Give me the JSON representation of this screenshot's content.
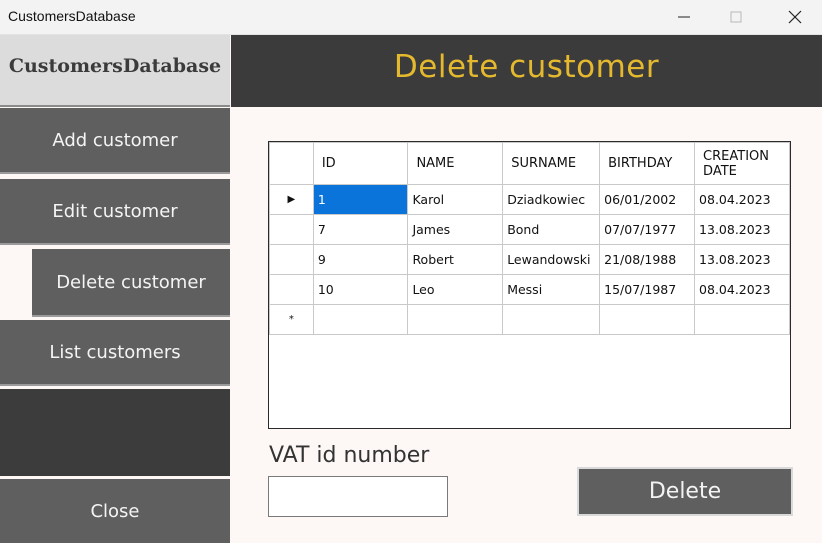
{
  "window": {
    "title": "CustomersDatabase"
  },
  "sidebar": {
    "brand": "CustomersDatabase",
    "items": [
      {
        "label": "Add customer"
      },
      {
        "label": "Edit customer"
      },
      {
        "label": "Delete customer"
      },
      {
        "label": "List customers"
      }
    ],
    "close_label": "Close"
  },
  "header": {
    "title": "Delete customer"
  },
  "grid": {
    "columns": [
      "ID",
      "NAME",
      "SURNAME",
      "BIRTHDAY",
      "CREATION DATE"
    ],
    "rows": [
      {
        "id": "1",
        "name": "Karol",
        "surname": "Dziadkowiec",
        "birthday": "06/01/2002",
        "created": "08.04.2023"
      },
      {
        "id": "7",
        "name": "James",
        "surname": "Bond",
        "birthday": "07/07/1977",
        "created": "13.08.2023"
      },
      {
        "id": "9",
        "name": "Robert",
        "surname": "Lewandowski",
        "birthday": "21/08/1988",
        "created": "13.08.2023"
      },
      {
        "id": "10",
        "name": "Leo",
        "surname": "Messi",
        "birthday": "15/07/1987",
        "created": "08.04.2023"
      }
    ],
    "current_row_marker": "▶",
    "new_row_marker": "*"
  },
  "form": {
    "vat_label": "VAT id number",
    "vat_value": "",
    "delete_label": "Delete"
  },
  "colors": {
    "accent": "#e5b92e",
    "header_bg": "#3b3b3b",
    "button_bg": "#5f5f5f",
    "selection": "#0a74da"
  }
}
